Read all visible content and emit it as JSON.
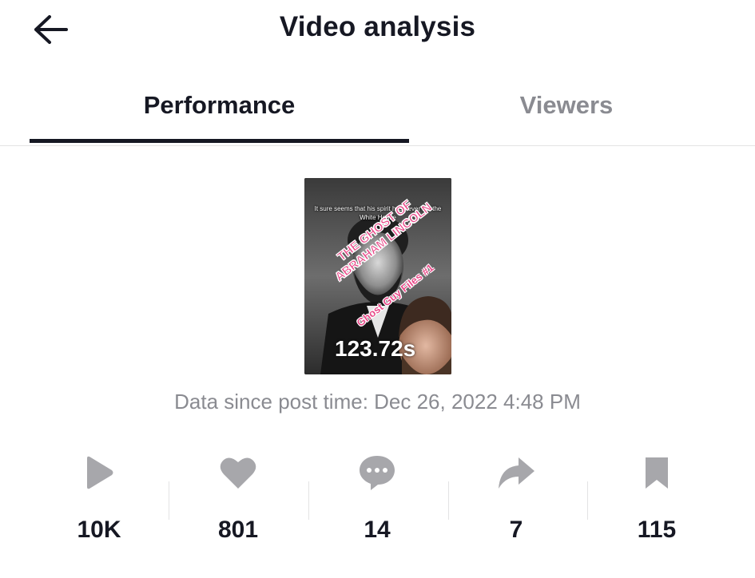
{
  "header": {
    "title": "Video analysis",
    "back_icon": "back-arrow-icon"
  },
  "tabs": [
    {
      "label": "Performance",
      "active": true
    },
    {
      "label": "Viewers",
      "active": false
    }
  ],
  "video": {
    "caption": "It sure seems that his spirit has never left the White House",
    "title_lines": [
      "THE GHOST OF",
      "ABRAHAM LINCOLN"
    ],
    "series": "Ghost Guy Files #1",
    "duration": "123.72s"
  },
  "data_since": "Data since post time: Dec 26, 2022 4:48 PM",
  "stats": [
    {
      "icon": "play-icon",
      "value": "10K"
    },
    {
      "icon": "heart-icon",
      "value": "801"
    },
    {
      "icon": "comment-icon",
      "value": "14"
    },
    {
      "icon": "share-icon",
      "value": "7"
    },
    {
      "icon": "bookmark-icon",
      "value": "115"
    }
  ],
  "colors": {
    "text_primary": "#161823",
    "text_secondary": "#8a8b91",
    "icon_gray": "#a7a7ab",
    "divider": "#e3e3e4",
    "accent_pink": "#e94b8a"
  }
}
